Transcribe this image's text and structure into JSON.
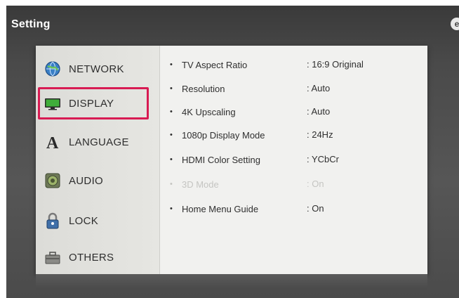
{
  "header": {
    "title": "Setting"
  },
  "menu": {
    "items": [
      {
        "label": "NETWORK",
        "icon": "globe-icon"
      },
      {
        "label": "DISPLAY",
        "icon": "monitor-icon",
        "selected": true
      },
      {
        "label": "LANGUAGE",
        "icon": "letter-a-icon"
      },
      {
        "label": "AUDIO",
        "icon": "speaker-icon"
      },
      {
        "label": "LOCK",
        "icon": "padlock-icon"
      },
      {
        "label": "OTHERS",
        "icon": "toolbox-icon"
      }
    ]
  },
  "settings": {
    "rows": [
      {
        "name": "TV Aspect Ratio",
        "value": ": 16:9 Original"
      },
      {
        "name": "Resolution",
        "value": ": Auto"
      },
      {
        "name": "4K Upscaling",
        "value": ": Auto"
      },
      {
        "name": "1080p Display Mode",
        "value": ": 24Hz"
      },
      {
        "name": "HDMI Color Setting",
        "value": ": YCbCr"
      },
      {
        "name": "3D Mode",
        "value": ": On",
        "disabled": true
      },
      {
        "name": "Home Menu Guide",
        "value": ": On"
      }
    ]
  },
  "colors": {
    "selection_outline": "#d81b53",
    "panel_bg": "#f1f1ef",
    "screen_bg": "#4a4a4a"
  }
}
